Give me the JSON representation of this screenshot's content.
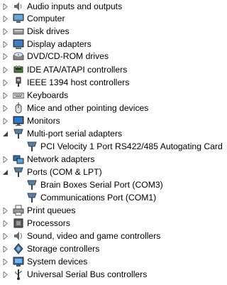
{
  "tree": {
    "nodes": [
      {
        "label": "Audio inputs and outputs",
        "expanded": false,
        "icon": "speaker-icon"
      },
      {
        "label": "Computer",
        "expanded": false,
        "icon": "computer-icon"
      },
      {
        "label": "Disk drives",
        "expanded": false,
        "icon": "disk-drive-icon"
      },
      {
        "label": "Display adapters",
        "expanded": false,
        "icon": "display-adapter-icon"
      },
      {
        "label": "DVD/CD-ROM drives",
        "expanded": false,
        "icon": "dvd-drive-icon"
      },
      {
        "label": "IDE ATA/ATAPI controllers",
        "expanded": false,
        "icon": "ide-controller-icon"
      },
      {
        "label": "IEEE 1394 host controllers",
        "expanded": false,
        "icon": "firewire-icon"
      },
      {
        "label": "Keyboards",
        "expanded": false,
        "icon": "keyboard-icon"
      },
      {
        "label": "Mice and other pointing devices",
        "expanded": false,
        "icon": "mouse-icon"
      },
      {
        "label": "Monitors",
        "expanded": false,
        "icon": "monitor-icon"
      },
      {
        "label": "Multi-port serial adapters",
        "expanded": true,
        "icon": "serial-port-icon",
        "children": [
          {
            "label": "PCI Velocity 1 Port RS422/485 Autogating Card",
            "icon": "serial-port-icon"
          }
        ]
      },
      {
        "label": "Network adapters",
        "expanded": false,
        "icon": "network-adapter-icon"
      },
      {
        "label": "Ports (COM & LPT)",
        "expanded": true,
        "icon": "serial-port-icon",
        "children": [
          {
            "label": "Brain Boxes Serial Port (COM3)",
            "icon": "serial-port-icon"
          },
          {
            "label": "Communications Port (COM1)",
            "icon": "serial-port-icon"
          }
        ]
      },
      {
        "label": "Print queues",
        "expanded": false,
        "icon": "printer-icon"
      },
      {
        "label": "Processors",
        "expanded": false,
        "icon": "processor-icon"
      },
      {
        "label": "Sound, video and game controllers",
        "expanded": false,
        "icon": "sound-icon"
      },
      {
        "label": "Storage controllers",
        "expanded": false,
        "icon": "storage-controller-icon"
      },
      {
        "label": "System devices",
        "expanded": false,
        "icon": "system-devices-icon"
      },
      {
        "label": "Universal Serial Bus controllers",
        "expanded": false,
        "icon": "usb-icon"
      }
    ]
  },
  "colors": {
    "expander": "#7a7a7a",
    "port_icon": "#4b6b86",
    "text": "#000000"
  }
}
